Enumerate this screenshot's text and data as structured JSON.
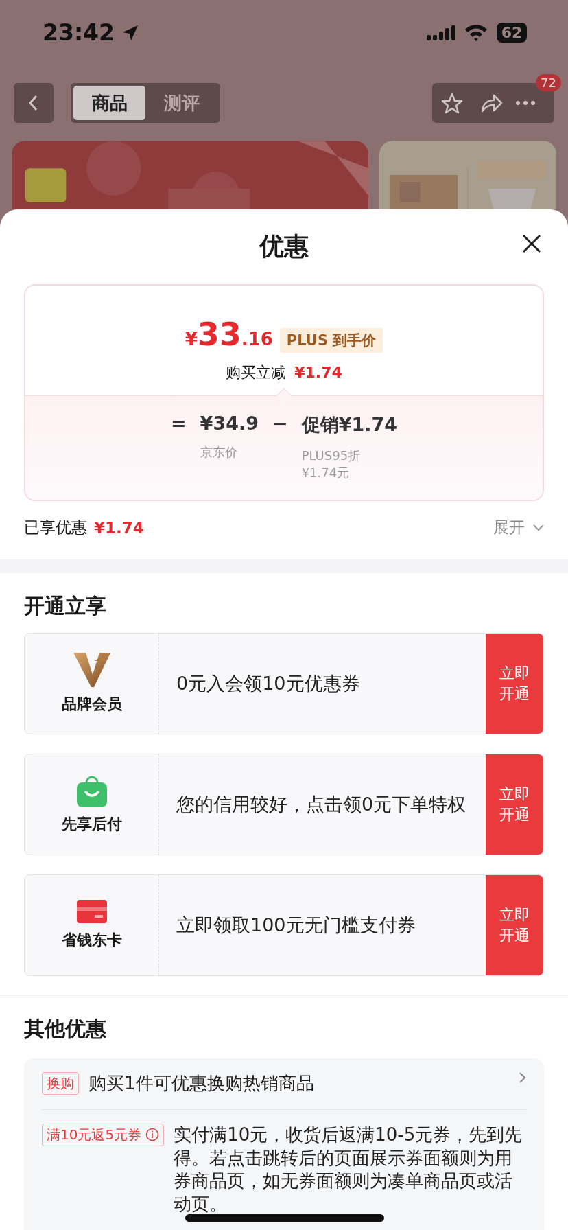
{
  "status_bar": {
    "time": "23:42",
    "battery": "62"
  },
  "nav": {
    "tabs": [
      {
        "label": "商品",
        "selected": true
      },
      {
        "label": "测评",
        "selected": false
      }
    ],
    "badge": "72"
  },
  "sheet": {
    "title": "优惠",
    "price_card": {
      "currency": "¥",
      "price_int": "33",
      "price_dec": ".16",
      "price_tag": "PLUS 到手价",
      "reduce_label": "购买立减",
      "reduce_amount": "¥1.74",
      "equals": "=",
      "base_price": "¥34.9",
      "base_label": "京东价",
      "minus": "−",
      "promo": "促销¥1.74",
      "promo_note_1": "PLUS95折",
      "promo_note_2": "¥1.74元"
    },
    "summary": {
      "label": "已享优惠",
      "amount": "¥1.74",
      "expand": "展开"
    },
    "open_section": {
      "title": "开通立享",
      "items": [
        {
          "kind": "brand",
          "name": "品牌会员",
          "desc": "0元入会领10元优惠券",
          "action": "立即开通"
        },
        {
          "kind": "bag",
          "name": "先享后付",
          "desc": "您的信用较好，点击领0元下单特权",
          "action": "立即开通"
        },
        {
          "kind": "card",
          "name": "省钱东卡",
          "desc": "立即领取100元无门槛支付券",
          "action": "立即开通"
        }
      ]
    },
    "other_section": {
      "title": "其他优惠",
      "items": [
        {
          "kind": "link",
          "tag": "换购",
          "text": "购买1件可优惠换购热销商品"
        },
        {
          "kind": "info",
          "tag": "满10元返5元券",
          "text": "实付满10元，收货后返满10-5元券，先到先得。若点击跳转后的页面展示券面额则为用券商品页，如无券面额则为凑单商品页或活动页。"
        }
      ]
    }
  }
}
